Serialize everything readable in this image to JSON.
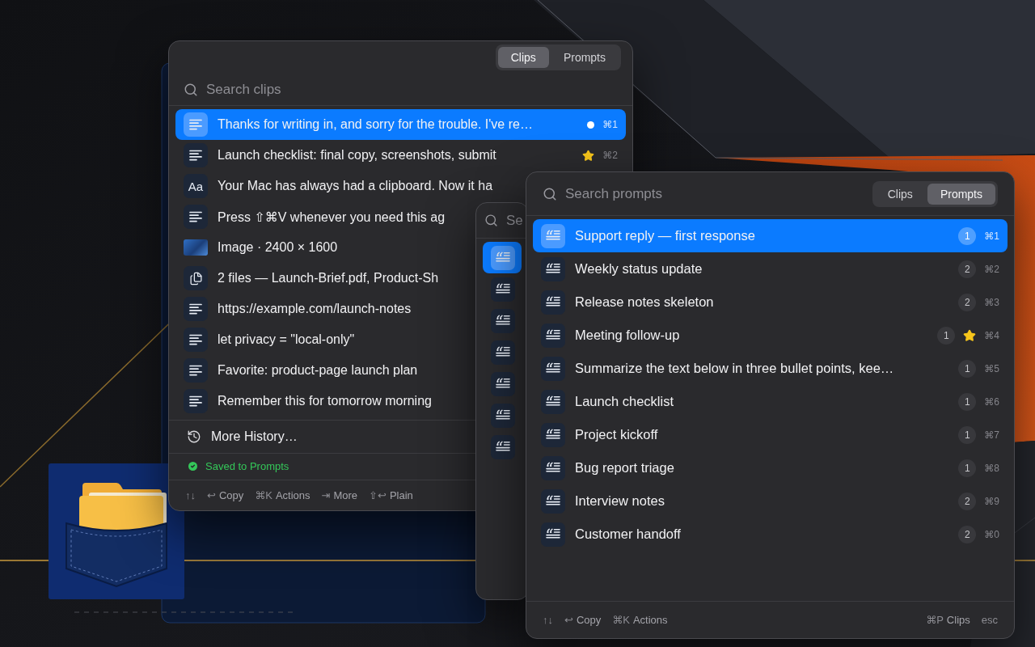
{
  "clips_window": {
    "tabs": [
      {
        "label": "Clips",
        "selected": true
      },
      {
        "label": "Prompts",
        "selected": false
      }
    ],
    "search": {
      "placeholder": "Search clips"
    },
    "rows": [
      {
        "kind": "text",
        "text": "Thanks for writing in, and sorry for the trouble. I've re…",
        "selected": true,
        "dot": true,
        "starred": false,
        "shortcut": "⌘1"
      },
      {
        "kind": "text",
        "text": "Launch checklist: final copy, screenshots, submit",
        "selected": false,
        "dot": false,
        "starred": true,
        "shortcut": "⌘2"
      },
      {
        "kind": "font",
        "icon_label": "Aa",
        "text": "Your Mac has always had a clipboard. Now it ha",
        "selected": false,
        "dot": false,
        "starred": false
      },
      {
        "kind": "text",
        "text": "Press ⇧⌘V whenever you need this ag",
        "selected": false,
        "dot": false,
        "starred": false
      },
      {
        "kind": "image",
        "text": "Image · 2400 × 1600",
        "selected": false,
        "dot": false,
        "starred": false
      },
      {
        "kind": "files",
        "text": "2 files — Launch-Brief.pdf, Product-Sh",
        "selected": false,
        "dot": false,
        "starred": false
      },
      {
        "kind": "text",
        "text": "https://example.com/launch-notes",
        "selected": false,
        "dot": false,
        "starred": false
      },
      {
        "kind": "text",
        "text": "let privacy = \"local-only\"",
        "selected": false,
        "dot": false,
        "starred": false
      },
      {
        "kind": "text",
        "text": "Favorite: product-page launch plan",
        "selected": false,
        "dot": false,
        "starred": false
      },
      {
        "kind": "text",
        "text": "Remember this for tomorrow morning",
        "selected": false,
        "dot": false,
        "starred": false
      }
    ],
    "more_history": "More History…",
    "status": {
      "kind": "success",
      "text": "Saved to Prompts"
    },
    "footer_hints": [
      {
        "key": "↑↓"
      },
      {
        "key": "↩",
        "label": "Copy"
      },
      {
        "key": "⌘K",
        "label": "Actions"
      },
      {
        "key": "⇥",
        "label": "More"
      },
      {
        "key": "⇧↩",
        "label": "Plain"
      }
    ]
  },
  "middle_window": {
    "search": {
      "placeholder": "Se"
    },
    "rows": [
      {
        "selected": true
      },
      {
        "selected": false
      },
      {
        "selected": false
      },
      {
        "selected": false
      },
      {
        "selected": false
      },
      {
        "selected": false
      },
      {
        "selected": false
      }
    ]
  },
  "prompts_window": {
    "search": {
      "placeholder": "Search prompts"
    },
    "tabs": [
      {
        "label": "Clips",
        "selected": false
      },
      {
        "label": "Prompts",
        "selected": true
      }
    ],
    "rows": [
      {
        "title": "Support reply — first response",
        "selected": true,
        "count": "1",
        "starred": false,
        "shortcut": "⌘1"
      },
      {
        "title": "Weekly status update",
        "selected": false,
        "count": "2",
        "starred": false,
        "shortcut": "⌘2"
      },
      {
        "title": "Release notes skeleton",
        "selected": false,
        "count": "2",
        "starred": false,
        "shortcut": "⌘3"
      },
      {
        "title": "Meeting follow-up",
        "selected": false,
        "count": "1",
        "starred": true,
        "shortcut": "⌘4"
      },
      {
        "title": "Summarize the text below in three bullet points, kee…",
        "selected": false,
        "count": "1",
        "starred": false,
        "shortcut": "⌘5"
      },
      {
        "title": "Launch checklist",
        "selected": false,
        "count": "1",
        "starred": false,
        "shortcut": "⌘6"
      },
      {
        "title": "Project kickoff",
        "selected": false,
        "count": "1",
        "starred": false,
        "shortcut": "⌘7"
      },
      {
        "title": "Bug report triage",
        "selected": false,
        "count": "1",
        "starred": false,
        "shortcut": "⌘8"
      },
      {
        "title": "Interview notes",
        "selected": false,
        "count": "2",
        "starred": false,
        "shortcut": "⌘9"
      },
      {
        "title": "Customer handoff",
        "selected": false,
        "count": "2",
        "starred": false,
        "shortcut": "⌘0"
      }
    ],
    "footer_hints": [
      {
        "key": "↑↓"
      },
      {
        "key": "↩",
        "label": "Copy"
      },
      {
        "key": "⌘K",
        "label": "Actions"
      }
    ],
    "footer_right": [
      {
        "key": "⌘P",
        "label": "Clips"
      },
      {
        "key": "esc"
      }
    ]
  }
}
